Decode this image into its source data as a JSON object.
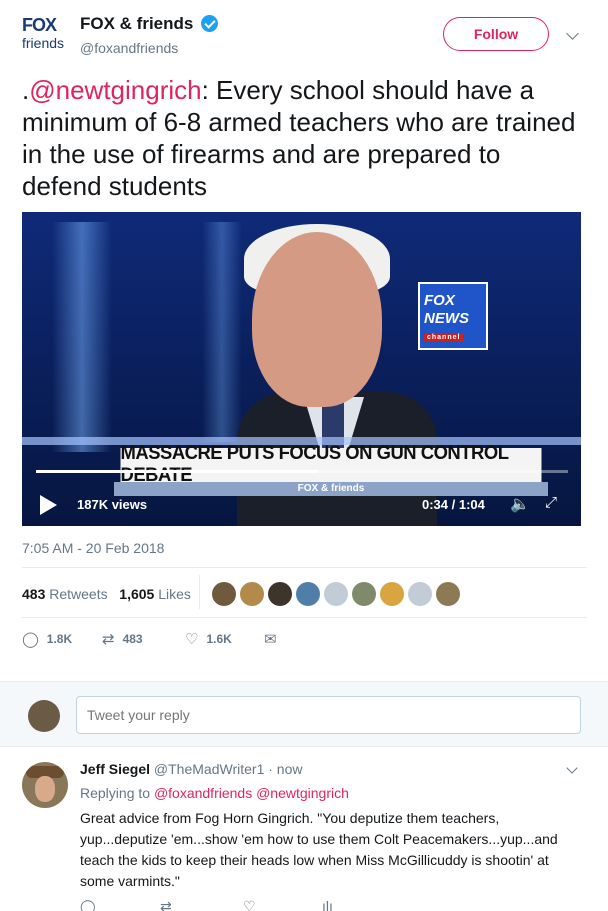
{
  "author": {
    "logo_top": "FOX",
    "logo_bottom": "friends",
    "name": "FOX & friends",
    "handle": "@foxandfriends",
    "follow_label": "Follow"
  },
  "tweet": {
    "prefix": ".",
    "mention": "@newtgingrich",
    "text": ": Every school should have a minimum of 6-8 armed teachers who are trained in the use of firearms and are prepared to defend students",
    "timestamp": "7:05 AM - 20 Feb 2018"
  },
  "video": {
    "chyron": "MASSACRE PUTS FOCUS ON GUN CONTROL DEBATE",
    "chyron_sub": "FOX & friends",
    "logo_line1": "FOX",
    "logo_line2": "NEWS",
    "logo_line3": "channel",
    "views": "187K views",
    "time": "0:34 / 1:04",
    "progress": 0.53
  },
  "stats": {
    "retweets_count": "483",
    "retweets_label": "Retweets",
    "likes_count": "1,605",
    "likes_label": "Likes",
    "liker_colors": [
      "#6f5a3e",
      "#b38a4a",
      "#3d342c",
      "#4f7fa8",
      "#c2ccd6",
      "#7f8a6a",
      "#d9a540",
      "#c2ccd6",
      "#8c7a55"
    ]
  },
  "actions": {
    "reply_count": "1.8K",
    "retweet_count": "483",
    "like_count": "1.6K"
  },
  "reply_box": {
    "placeholder": "Tweet your reply"
  },
  "reply": {
    "name": "Jeff Siegel",
    "handle": "@TheMadWriter1",
    "time": "· now",
    "replying_prefix": "Replying to",
    "replying_to": "@foxandfriends @newtgingrich",
    "text": "Great advice from Fog Horn Gingrich. \"You deputize them teachers, yup...deputize 'em...show 'em how to use them Colt Peacemakers...yup...and teach the kids to keep their heads low when Miss McGillicuddy is shootin' at some varmints.\""
  }
}
